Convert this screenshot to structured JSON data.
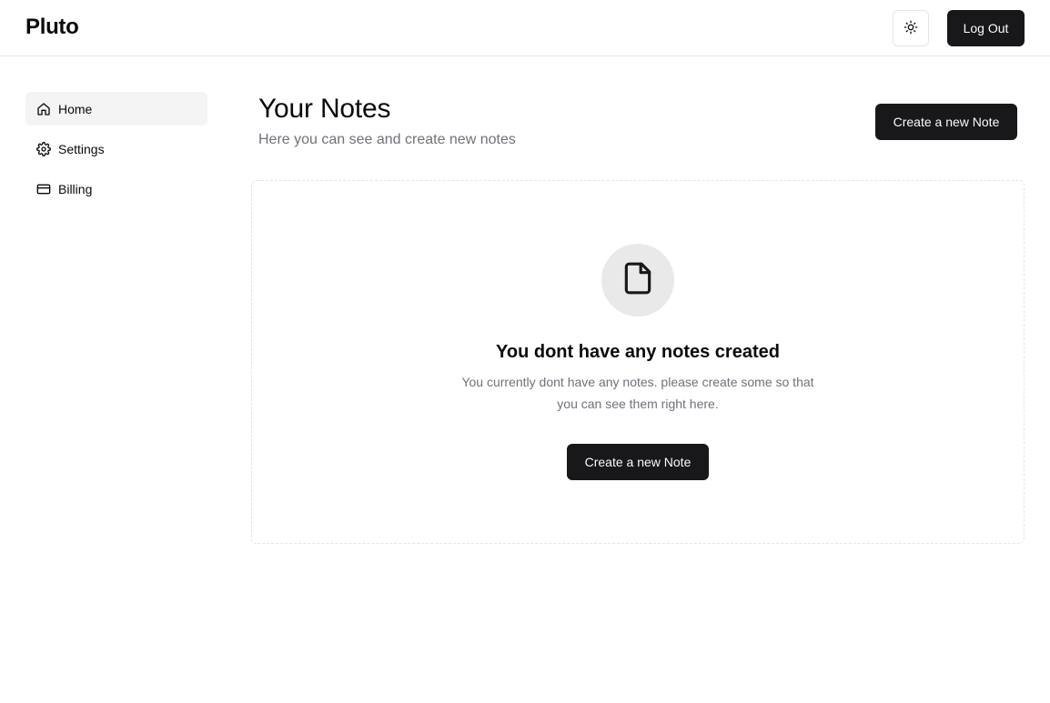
{
  "app": {
    "brand": "Pluto"
  },
  "header": {
    "theme_toggle_icon": "sun-icon",
    "logout_label": "Log Out"
  },
  "sidebar": {
    "items": [
      {
        "label": "Home",
        "icon": "home-icon",
        "active": true
      },
      {
        "label": "Settings",
        "icon": "gear-icon",
        "active": false
      },
      {
        "label": "Billing",
        "icon": "credit-card-icon",
        "active": false
      }
    ]
  },
  "main": {
    "title": "Your Notes",
    "subtitle": "Here you can see and create new notes",
    "create_button_label": "Create a new Note",
    "empty_state": {
      "icon": "file-icon",
      "title": "You dont have any notes created",
      "description": "You currently dont have any notes. please create some so that you can see them right here.",
      "button_label": "Create a new Note"
    }
  },
  "colors": {
    "primary": "#18181b",
    "muted_text": "#71717a",
    "active_nav_bg": "#f4f4f5",
    "border": "#e5e5e5"
  }
}
